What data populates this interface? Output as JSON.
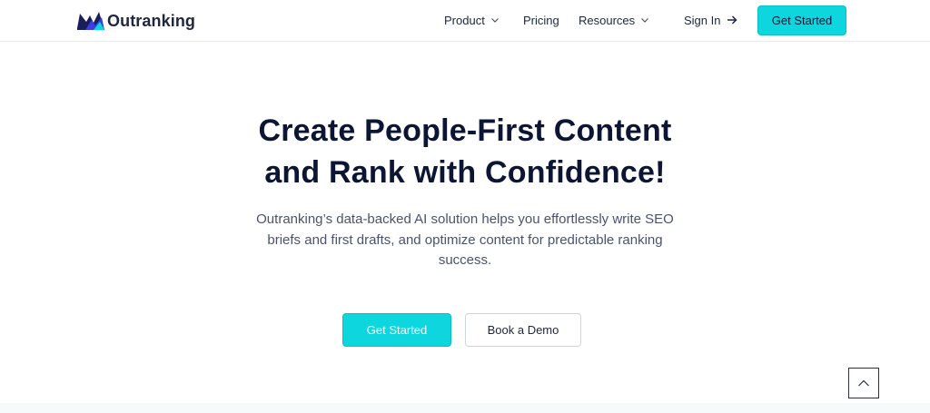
{
  "brand": {
    "name": "Outranking",
    "icon": "outranking-logo-icon",
    "colors": {
      "accent": "#0dd6de",
      "text": "#0c1533",
      "logo_blue": "#3a3ee0",
      "logo_dark": "#1a1f5c"
    }
  },
  "nav": {
    "items": [
      {
        "label": "Product",
        "has_dropdown": true,
        "icon": "chevron-down-icon"
      },
      {
        "label": "Pricing",
        "has_dropdown": false
      },
      {
        "label": "Resources",
        "has_dropdown": true,
        "icon": "chevron-down-icon"
      }
    ],
    "sign_in": {
      "label": "Sign In",
      "icon": "arrow-right-icon"
    },
    "cta": {
      "label": "Get Started"
    }
  },
  "hero": {
    "title_line1": "Create People-First Content",
    "title_line2": "and Rank with Confidence!",
    "subtitle": "Outranking’s data-backed AI solution helps you effortlessly write SEO briefs and first drafts, and optimize content for predictable ranking success.",
    "primary_button": "Get Started",
    "secondary_button": "Book a Demo"
  },
  "scroll_top": {
    "icon": "chevron-up-icon"
  }
}
